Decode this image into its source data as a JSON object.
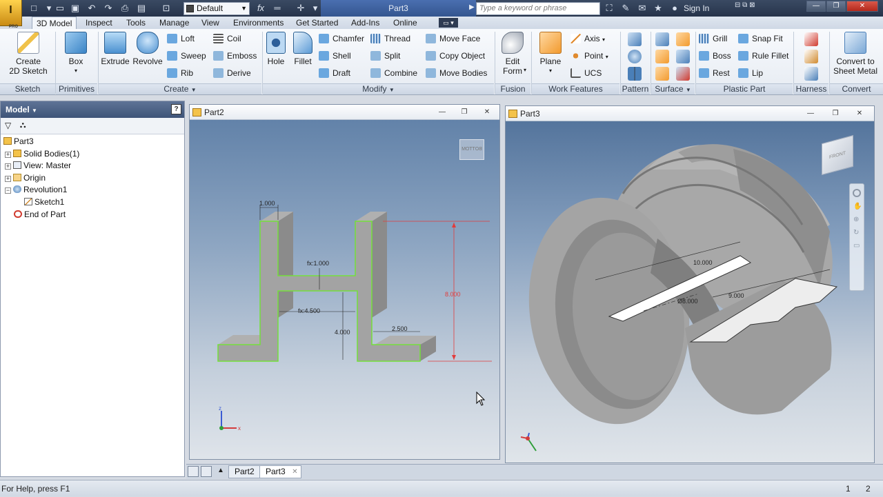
{
  "app": {
    "title": "Part3",
    "logo_sub": "PRO"
  },
  "quick_access": {
    "style_value": "Default",
    "search_placeholder": "Type a keyword or phrase",
    "sign_in": "Sign In"
  },
  "menu_tabs": [
    "3D Model",
    "Inspect",
    "Tools",
    "Manage",
    "View",
    "Environments",
    "Get Started",
    "Add-Ins",
    "Online"
  ],
  "ribbon": {
    "sketch": {
      "btn": "Create\n2D Sketch",
      "panel": "Sketch"
    },
    "primitives": {
      "btn": "Box",
      "panel": "Primitives"
    },
    "create": {
      "extrude": "Extrude",
      "revolve": "Revolve",
      "loft": "Loft",
      "coil": "Coil",
      "sweep": "Sweep",
      "emboss": "Emboss",
      "rib": "Rib",
      "derive": "Derive",
      "panel": "Create"
    },
    "modify": {
      "hole": "Hole",
      "fillet": "Fillet",
      "chamfer": "Chamfer",
      "thread": "Thread",
      "move_face": "Move Face",
      "shell": "Shell",
      "split": "Split",
      "copy_object": "Copy Object",
      "draft": "Draft",
      "combine": "Combine",
      "move_bodies": "Move Bodies",
      "panel": "Modify"
    },
    "fusion": {
      "btn": "Edit\nForm",
      "panel": "Fusion"
    },
    "work_features": {
      "plane": "Plane",
      "axis": "Axis",
      "point": "Point",
      "ucs": "UCS",
      "panel": "Work Features"
    },
    "pattern": {
      "panel": "Pattern"
    },
    "surface": {
      "panel": "Surface"
    },
    "plastic_part": {
      "grill": "Grill",
      "snap_fit": "Snap Fit",
      "boss": "Boss",
      "rule_fillet": "Rule Fillet",
      "rest": "Rest",
      "lip": "Lip",
      "panel": "Plastic Part"
    },
    "harness": {
      "panel": "Harness"
    },
    "convert": {
      "btn": "Convert to\nSheet Metal",
      "panel": "Convert"
    }
  },
  "model_browser": {
    "title": "Model",
    "help": "?",
    "tree": [
      {
        "label": "Part3",
        "indent": 0
      },
      {
        "label": "Solid Bodies(1)",
        "indent": 1
      },
      {
        "label": "View: Master",
        "indent": 1
      },
      {
        "label": "Origin",
        "indent": 1
      },
      {
        "label": "Revolution1",
        "indent": 1
      },
      {
        "label": "Sketch1",
        "indent": 2
      },
      {
        "label": "End of Part",
        "indent": 1
      }
    ]
  },
  "viewports": {
    "part2": {
      "title": "Part2",
      "viewcube": "BOTTOM",
      "dims": {
        "top_width": "1.000",
        "fx_1": "fx:1.000",
        "fx_4_5": "fx:4.500",
        "d_2_5": "2.500",
        "d_4": "4.000",
        "d_8": "8.000"
      }
    },
    "part3": {
      "title": "Part3",
      "viewcube": "FRONT",
      "dims": {
        "d_10": "10.000",
        "d_9": "9.000",
        "d_phi8": "Ø8.000"
      }
    }
  },
  "doc_tabs": [
    "Part2",
    "Part3"
  ],
  "status": {
    "help_text": "For Help, press F1",
    "n1": "1",
    "n2": "2"
  }
}
